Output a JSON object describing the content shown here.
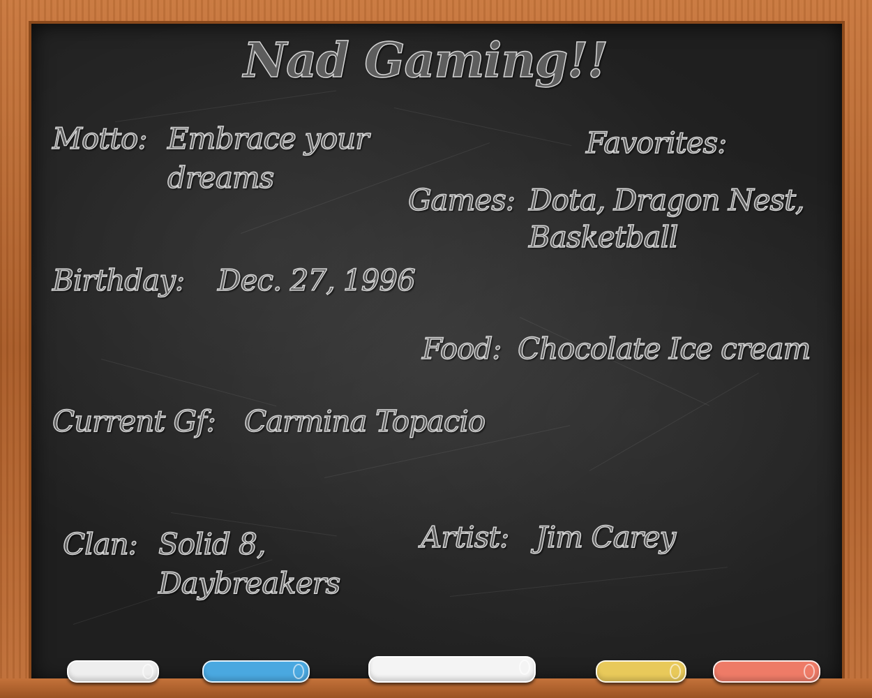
{
  "title": "Nad Gaming!!",
  "motto": {
    "label": "Motto:",
    "line1": "Embrace your",
    "line2": "dreams"
  },
  "favorites": {
    "heading": "Favorites:",
    "games": {
      "label": "Games:",
      "line1": "Dota, Dragon Nest,",
      "line2": "Basketball"
    },
    "food": {
      "label": "Food:",
      "value": "Chocolate Ice cream"
    },
    "artist": {
      "label": "Artist:",
      "value": "Jim Carey"
    }
  },
  "birthday": {
    "label": "Birthday:",
    "value": "Dec. 27, 1996"
  },
  "girlfriend": {
    "label": "Current Gf:",
    "value": "Carmina Topacio"
  },
  "clan": {
    "label": "Clan:",
    "line1": "Solid 8,",
    "line2": "Daybreakers"
  },
  "chalk_colors": {
    "white_left": "#eeeeee",
    "blue": "#4aa8e0",
    "white_center": "#f4f4f4",
    "yellow": "#e8c95a",
    "pink": "#ee7b67"
  }
}
